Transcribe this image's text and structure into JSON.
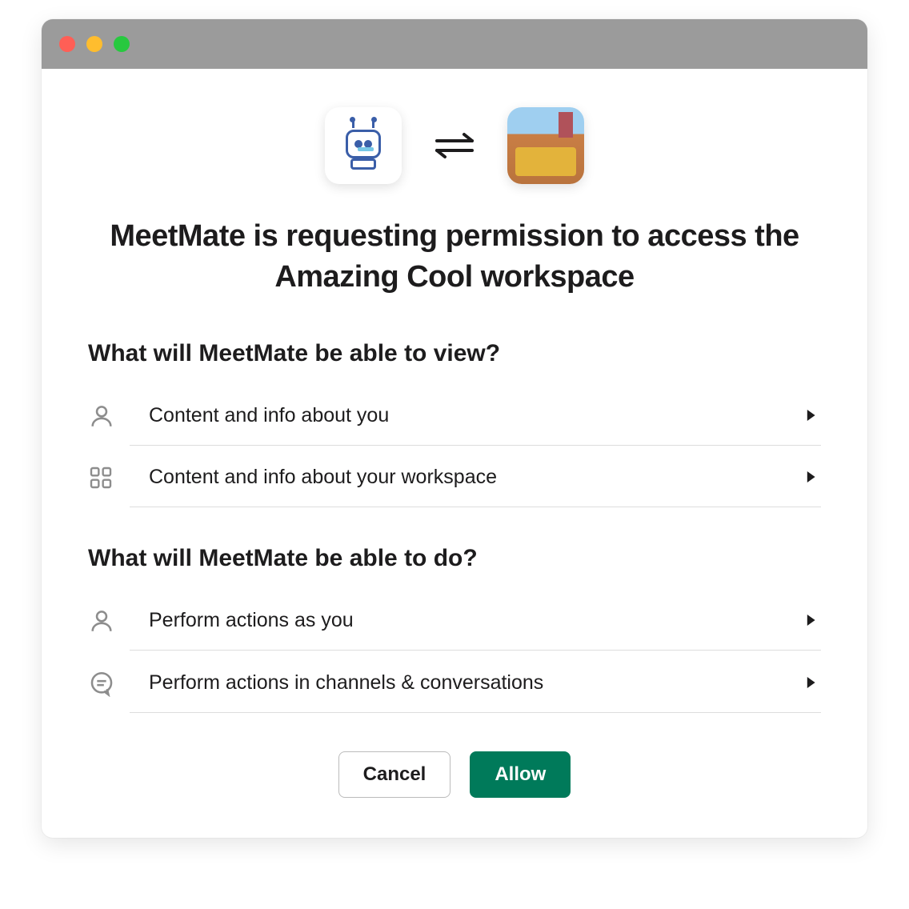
{
  "header": {
    "app_name": "MeetMate",
    "workspace_name": "Amazing Cool",
    "headline": "MeetMate is requesting permission to access the Amazing Cool workspace"
  },
  "sections": {
    "view": {
      "title": "What will MeetMate be able to view?",
      "items": [
        {
          "icon": "user-icon",
          "label": "Content and info about you"
        },
        {
          "icon": "grid-icon",
          "label": "Content and info about your workspace"
        }
      ]
    },
    "do": {
      "title": "What will MeetMate be able to do?",
      "items": [
        {
          "icon": "user-icon",
          "label": "Perform actions as you"
        },
        {
          "icon": "chat-icon",
          "label": "Perform actions in channels & conversations"
        }
      ]
    }
  },
  "buttons": {
    "cancel": "Cancel",
    "allow": "Allow"
  }
}
